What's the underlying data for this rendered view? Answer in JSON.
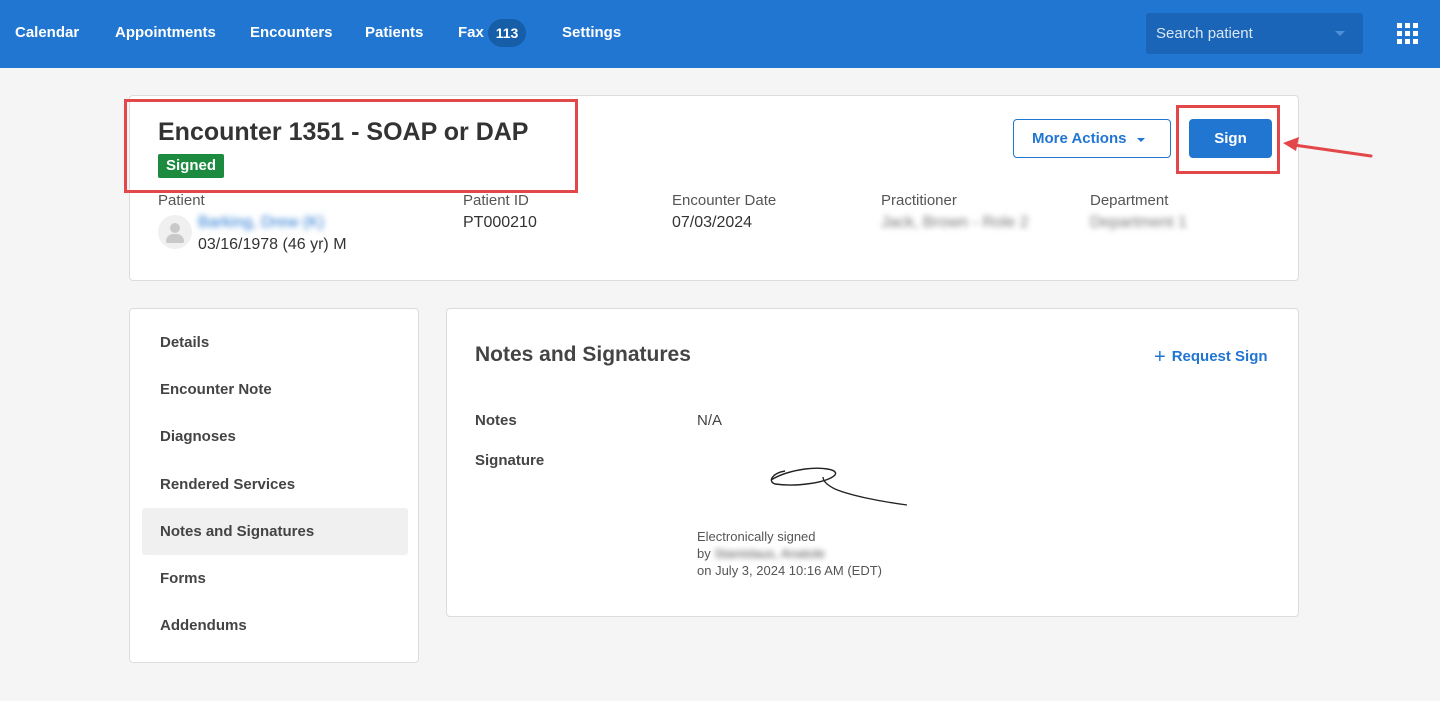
{
  "nav": {
    "items": [
      "Calendar",
      "Appointments",
      "Encounters",
      "Patients",
      "Fax",
      "Settings"
    ],
    "fax_count": "113",
    "search_placeholder": "Search patient",
    "apps_icon": "grid-icon"
  },
  "encounter": {
    "title": "Encounter 1351 - SOAP or DAP",
    "status": "Signed",
    "more_actions_label": "More Actions",
    "sign_label": "Sign",
    "patient_label": "Patient",
    "patient_name": "Barking, Drew (K)",
    "patient_dob": "03/16/1978 (46 yr) M",
    "patient_id_label": "Patient ID",
    "patient_id": "PT000210",
    "date_label": "Encounter Date",
    "date": "07/03/2024",
    "practitioner_label": "Practitioner",
    "practitioner": "Jack, Brown - Role 2",
    "department_label": "Department",
    "department": "Department 1"
  },
  "sidebar": {
    "items": [
      {
        "label": "Details"
      },
      {
        "label": "Encounter Note"
      },
      {
        "label": "Diagnoses"
      },
      {
        "label": "Rendered Services"
      },
      {
        "label": "Notes and Signatures"
      },
      {
        "label": "Forms"
      },
      {
        "label": "Addendums"
      }
    ],
    "active": "Notes and Signatures"
  },
  "notes": {
    "title": "Notes and Signatures",
    "request_sign_label": "Request Sign",
    "notes_label": "Notes",
    "notes_value": "N/A",
    "signature_label": "Signature",
    "signed_line1": "Electronically signed",
    "signed_by_prefix": "by",
    "signed_by_name": "Stanislaus, Anatole",
    "signed_on": "on July 3, 2024 10:16 AM (EDT)"
  },
  "colors": {
    "brand": "#2176d2",
    "signed_badge": "#1c8a3f",
    "highlight": "#e2474a"
  }
}
